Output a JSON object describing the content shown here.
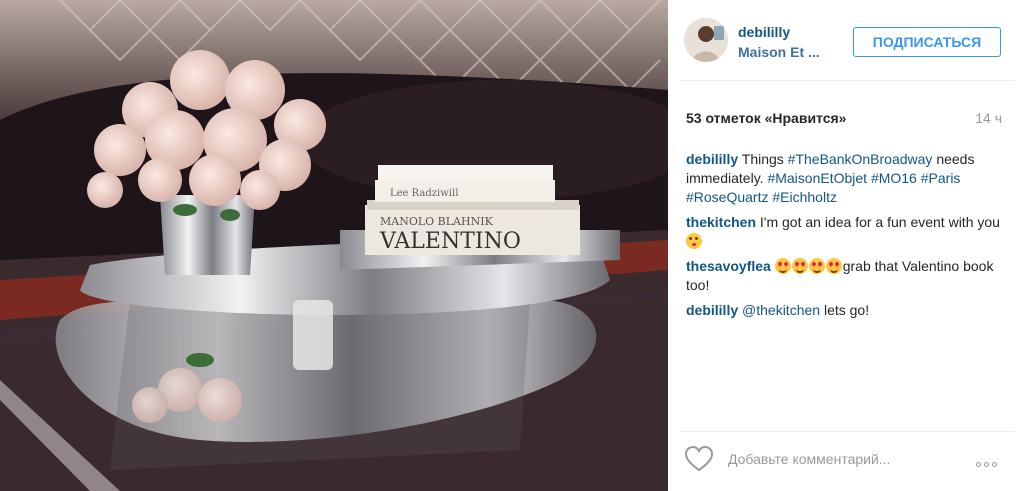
{
  "post": {
    "username": "debililly",
    "location": "Maison Et ...",
    "follow_label": "ПОДПИСАТЬСЯ",
    "likes": "53 отметок «Нравится»",
    "time": "14 ч",
    "photo_alt": "Flowers and books on a mirrored table",
    "comments": [
      {
        "user": "debililly",
        "parts": [
          {
            "text": " Things ",
            "tag": false
          },
          {
            "text": "#TheBankOnBroadway",
            "tag": true
          },
          {
            "text": " needs immediately. ",
            "tag": false
          },
          {
            "text": "#MaisonEtObjet",
            "tag": true
          },
          {
            "text": " ",
            "tag": false
          },
          {
            "text": "#MO16",
            "tag": true
          },
          {
            "text": " ",
            "tag": false
          },
          {
            "text": "#Paris",
            "tag": true
          },
          {
            "text": " ",
            "tag": false
          },
          {
            "text": "#RoseQuartz",
            "tag": true
          },
          {
            "text": " ",
            "tag": false
          },
          {
            "text": "#Eichholtz",
            "tag": true
          }
        ]
      },
      {
        "user": "thekitchen",
        "text": " I'm got an idea for a fun event with you "
      },
      {
        "user": "thesavoyflea",
        "text": "grab that Valentino book too!"
      },
      {
        "user": "debililly",
        "mention": "@thekitchen",
        "text": " lets go!"
      }
    ]
  },
  "footer": {
    "comment_placeholder": "Добавьте комментарий..."
  },
  "colors": {
    "link": "#125688",
    "location": "#3f729b",
    "button": "#3897f0"
  },
  "icons": {
    "like": "heart-icon",
    "more": "more-options-icon"
  }
}
